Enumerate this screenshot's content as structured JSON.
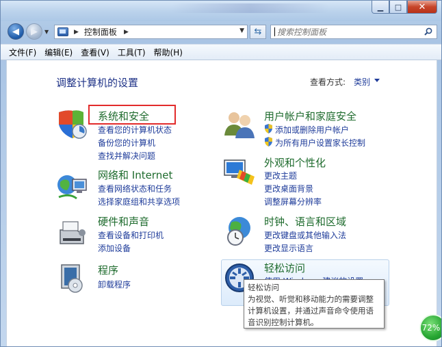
{
  "address": {
    "root_label": "控制面板"
  },
  "search": {
    "placeholder": "搜索控制面板"
  },
  "menu": [
    "文件(F)",
    "编辑(E)",
    "查看(V)",
    "工具(T)",
    "帮助(H)"
  ],
  "content": {
    "title": "调整计算机的设置",
    "view_by_label": "查看方式:",
    "view_by_value": "类别"
  },
  "categories": [
    {
      "title": "系统和安全",
      "icon": "system-security-icon",
      "links": [
        "查看您的计算机状态",
        "备份您的计算机",
        "查找并解决问题"
      ]
    },
    {
      "title": "网络和 Internet",
      "icon": "network-internet-icon",
      "links": [
        "查看网络状态和任务",
        "选择家庭组和共享选项"
      ]
    },
    {
      "title": "硬件和声音",
      "icon": "hardware-sound-icon",
      "links": [
        "查看设备和打印机",
        "添加设备"
      ]
    },
    {
      "title": "程序",
      "icon": "programs-icon",
      "links": [
        "卸载程序"
      ]
    },
    {
      "title": "用户帐户和家庭安全",
      "icon": "user-accounts-icon",
      "links": [
        "添加或删除用户帐户",
        "为所有用户设置家长控制"
      ]
    },
    {
      "title": "外观和个性化",
      "icon": "appearance-icon",
      "links": [
        "更改主题",
        "更改桌面背景",
        "调整屏幕分辨率"
      ]
    },
    {
      "title": "时钟、语言和区域",
      "icon": "clock-language-icon",
      "links": [
        "更改键盘或其他输入法",
        "更改显示语言"
      ]
    },
    {
      "title": "轻松访问",
      "icon": "ease-of-access-icon",
      "links": [
        "使用 Windows 建议的设置"
      ]
    }
  ],
  "tooltip": {
    "title": "轻松访问",
    "lines": [
      "为视觉、听觉和移动能力的需要调整",
      "计算机设置，并通过声音命令使用语",
      "音识别控制计算机。"
    ]
  },
  "badge": {
    "text": "72%"
  },
  "colors": {
    "category_title": "#1e6b2d",
    "link": "#1f3c9a",
    "highlight": "#e22b2b"
  }
}
